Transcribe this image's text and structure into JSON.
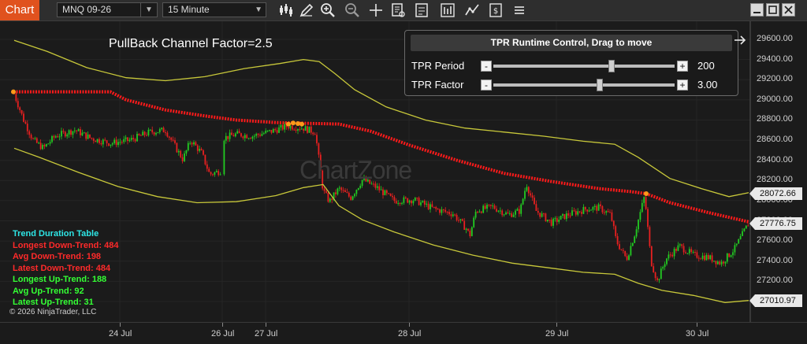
{
  "toolbar": {
    "chart_tab": "Chart",
    "instrument": "MNQ 09-26",
    "interval": "15 Minute",
    "icons": [
      "bar-style-icon",
      "draw-pencil-icon",
      "zoom-in-icon",
      "zoom-out-icon",
      "crosshair-icon",
      "data-box-icon",
      "properties-icon",
      "indicators-icon",
      "strategies-icon",
      "templates-icon",
      "more-icon"
    ]
  },
  "chart": {
    "overlay_title": "PullBack Channel Factor=2.5",
    "watermark": "ChartZone",
    "price_axis": [
      "29600.00",
      "29400.00",
      "29200.00",
      "29000.00",
      "28800.00",
      "28600.00",
      "28400.00",
      "28200.00",
      "28000.00",
      "27800.00",
      "27600.00",
      "27400.00",
      "27200.00",
      "27000.00"
    ],
    "price_tags": [
      "28072.66",
      "27776.75",
      "27010.97"
    ],
    "time_axis": [
      "24 Jul",
      "26 Jul",
      "27 Jul",
      "28 Jul",
      "29 Jul",
      "30 Jul"
    ],
    "colors": {
      "candle_up": "#22cc22",
      "candle_down": "#e82020",
      "trend_line": "#ff1a1a",
      "channel": "#c8c83a",
      "pivot": "#ff9a1a",
      "background": "#1b1b1b"
    }
  },
  "control_panel": {
    "title": "TPR Runtime Control, Drag to move",
    "period_label": "TPR Period",
    "period_value": "200",
    "factor_label": "TPR Factor",
    "factor_value": "3.00",
    "minus": "-",
    "plus": "+"
  },
  "trend_table": {
    "title": "Trend Duration Table",
    "longest_down": "Longest Down-Trend: 484",
    "avg_down": "Avg Down-Trend: 198",
    "latest_down": "Latest Down-Trend: 484",
    "longest_up": "Longest Up-Trend: 188",
    "avg_up": "Avg Up-Trend: 92",
    "latest_up": "Latest Up-Trend: 31"
  },
  "copyright": "© 2026 NinjaTrader, LLC"
}
